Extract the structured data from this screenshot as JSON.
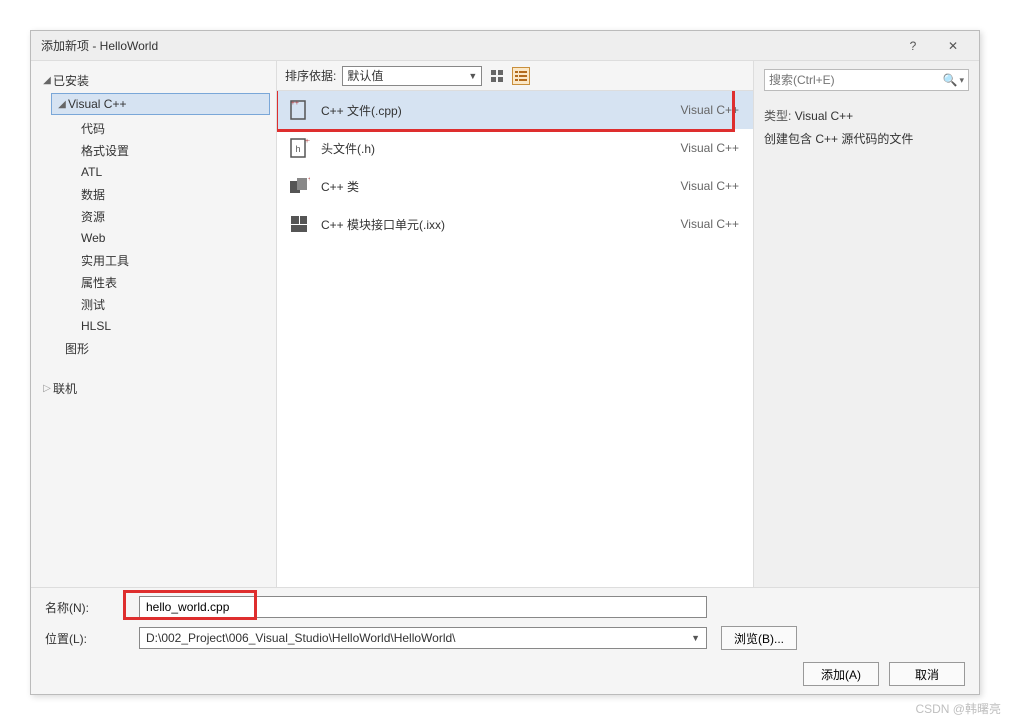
{
  "dialog": {
    "title": "添加新项 - HelloWorld",
    "help_tooltip": "?",
    "close_tooltip": "✕"
  },
  "sidebar": {
    "installed_label": "已安装",
    "online_label": "联机",
    "vcpp_label": "Visual C++",
    "children": [
      {
        "label": "代码"
      },
      {
        "label": "格式设置"
      },
      {
        "label": "ATL"
      },
      {
        "label": "数据"
      },
      {
        "label": "资源"
      },
      {
        "label": "Web"
      },
      {
        "label": "实用工具"
      },
      {
        "label": "属性表"
      },
      {
        "label": "测试"
      },
      {
        "label": "HLSL"
      }
    ],
    "graphics_label": "图形"
  },
  "toolbar": {
    "sort_label": "排序依据:",
    "sort_value": "默认值"
  },
  "search": {
    "placeholder": "搜索(Ctrl+E)"
  },
  "templates": [
    {
      "name": "C++ 文件(.cpp)",
      "category": "Visual C++",
      "selected": true
    },
    {
      "name": "头文件(.h)",
      "category": "Visual C++",
      "selected": false
    },
    {
      "name": "C++ 类",
      "category": "Visual C++",
      "selected": false
    },
    {
      "name": "C++ 模块接口单元(.ixx)",
      "category": "Visual C++",
      "selected": false
    }
  ],
  "details": {
    "type_label": "类型:",
    "type_value": "Visual C++",
    "description": "创建包含 C++ 源代码的文件"
  },
  "bottom": {
    "name_label": "名称(N):",
    "name_value": "hello_world.cpp",
    "location_label": "位置(L):",
    "location_value": "D:\\002_Project\\006_Visual_Studio\\HelloWorld\\HelloWorld\\",
    "browse_label": "浏览(B)...",
    "add_label": "添加(A)",
    "cancel_label": "取消"
  },
  "watermark": "CSDN @韩曙亮"
}
